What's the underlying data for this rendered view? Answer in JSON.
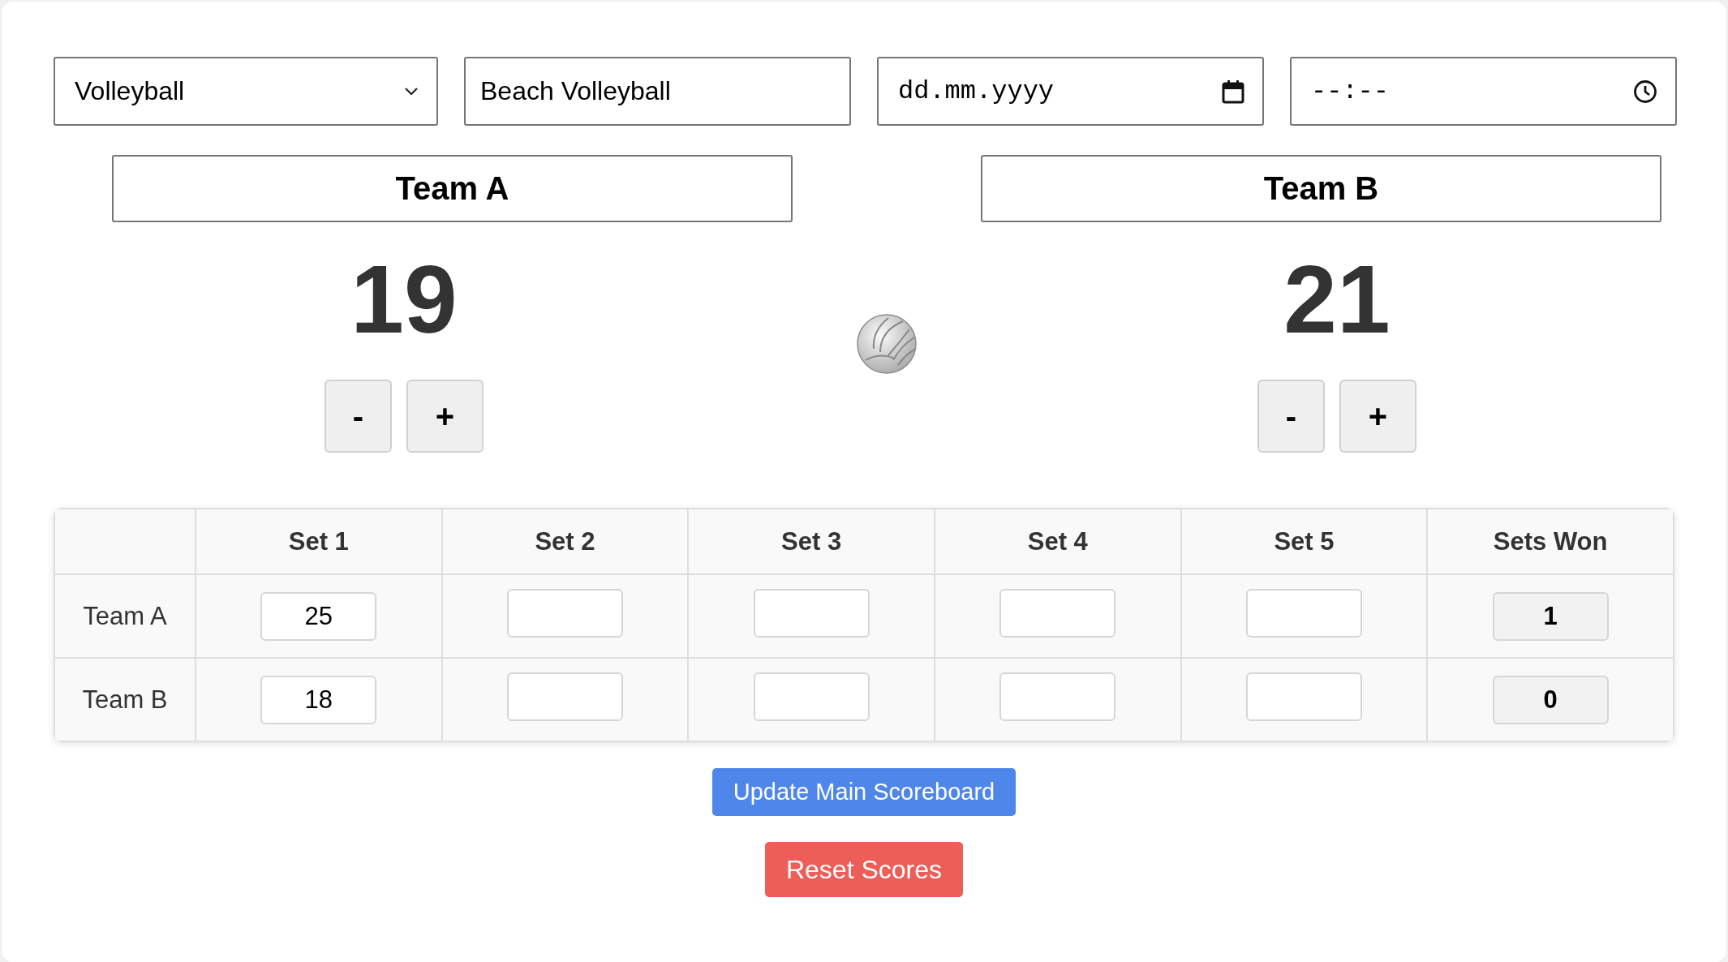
{
  "sport_select": {
    "value": "Volleyball"
  },
  "event_name": {
    "value": "Beach Volleyball"
  },
  "date_field": {
    "placeholder": "dd.mm.yyyy"
  },
  "time_field": {
    "placeholder": "--:--"
  },
  "teams": [
    {
      "name": "Team A",
      "score": "19",
      "decrement": "-",
      "increment": "+"
    },
    {
      "name": "Team B",
      "score": "21",
      "decrement": "-",
      "increment": "+"
    }
  ],
  "sets_table": {
    "columns": [
      "Set 1",
      "Set 2",
      "Set 3",
      "Set 4",
      "Set 5",
      "Sets Won"
    ],
    "rows": [
      {
        "team": "Team A",
        "set_scores": [
          "25"
        ],
        "sets_won": "1"
      },
      {
        "team": "Team B",
        "set_scores": [
          "18"
        ],
        "sets_won": "0"
      }
    ]
  },
  "buttons": [
    {
      "kind": "primary",
      "label": "Update Main Scoreboard"
    },
    {
      "kind": "danger",
      "label": "Reset Scores"
    }
  ]
}
